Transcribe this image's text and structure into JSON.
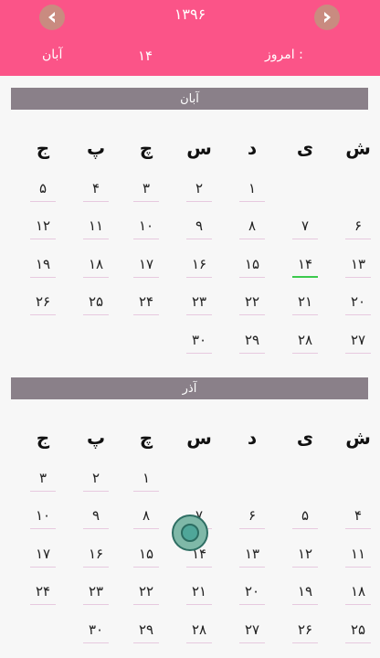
{
  "header": {
    "year": "۱۳۹۶",
    "today_label": "امروز :",
    "today_day": "۱۴",
    "today_month": "آبان",
    "prev_icon": "chevron-left-icon",
    "next_icon": "chevron-right-icon"
  },
  "weekdays": [
    "ش",
    "ی",
    "د",
    "س",
    "چ",
    "پ",
    "ج"
  ],
  "months": [
    {
      "name": "آبان",
      "rows": [
        [
          "",
          "",
          "",
          "۱",
          "۲",
          "۳",
          "۴",
          "۵"
        ],
        [
          "۶",
          "۷",
          "۸",
          "۹",
          "۱۰",
          "۱۱",
          "۱۲"
        ],
        [
          "۱۳",
          "۱۴",
          "۱۵",
          "۱۶",
          "۱۷",
          "۱۸",
          "۱۹"
        ],
        [
          "۲۰",
          "۲۱",
          "۲۲",
          "۲۳",
          "۲۴",
          "۲۵",
          "۲۶"
        ],
        [
          "۲۷",
          "۲۸",
          "۲۹",
          "۳۰",
          "",
          "",
          ""
        ]
      ],
      "today": "۱۴"
    },
    {
      "name": "آذر",
      "rows": [
        [
          "",
          "",
          "",
          "",
          "۱",
          "۲",
          "۳"
        ],
        [
          "۴",
          "۵",
          "۶",
          "۷",
          "۸",
          "۹",
          "۱۰"
        ],
        [
          "۱۱",
          "۱۲",
          "۱۳",
          "۱۴",
          "۱۵",
          "۱۶",
          "۱۷"
        ],
        [
          "۱۸",
          "۱۹",
          "۲۰",
          "۲۱",
          "۲۲",
          "۲۳",
          "۲۴"
        ],
        [
          "۲۵",
          "۲۶",
          "۲۷",
          "۲۸",
          "۲۹",
          "۳۰",
          ""
        ]
      ]
    }
  ],
  "colors": {
    "header": "#fb5488",
    "month_bar": "#8a8089",
    "today_underline": "#3cc94d"
  }
}
